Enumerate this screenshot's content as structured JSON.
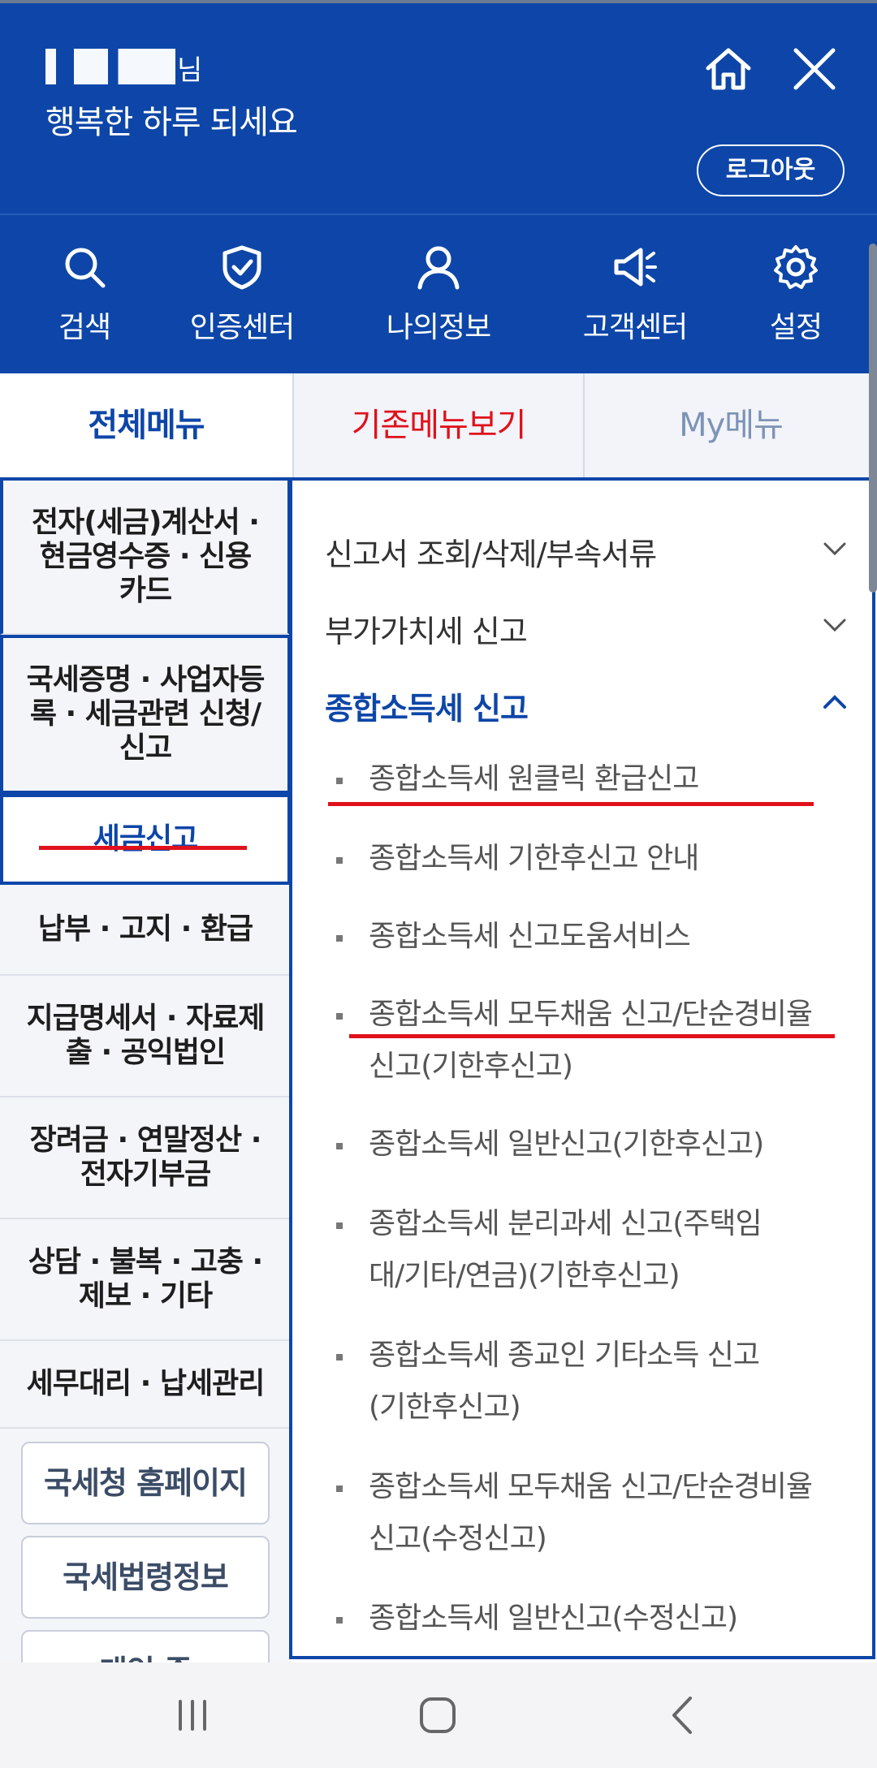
{
  "header": {
    "username_suffix": "님",
    "greeting": "행복한 하루 되세요",
    "logout_label": "로그아웃",
    "color": "#0d46a8"
  },
  "quick_nav": [
    {
      "label": "검색",
      "icon": "search-icon"
    },
    {
      "label": "인증센터",
      "icon": "shield-check-icon"
    },
    {
      "label": "나의정보",
      "icon": "user-icon"
    },
    {
      "label": "고객센터",
      "icon": "megaphone-icon"
    },
    {
      "label": "설정",
      "icon": "gear-icon"
    }
  ],
  "tabs": [
    {
      "label": "전체메뉴",
      "active": true
    },
    {
      "label": "기존메뉴보기",
      "color": "#e0111b"
    },
    {
      "label": "My메뉴"
    }
  ],
  "categories": [
    {
      "label": "전자(세금)계산서 · 현금영수증 · 신용카드"
    },
    {
      "label": "국세증명 · 사업자등록 · 세금관련 신청/신고"
    },
    {
      "label": "세금신고",
      "active": true
    },
    {
      "label": "납부 · 고지 · 환급"
    },
    {
      "label": "지급명세서 · 자료제출 · 공익법인"
    },
    {
      "label": "장려금 · 연말정산 · 전자기부금"
    },
    {
      "label": "상담 · 불복 · 고충 · 제보 · 기타"
    },
    {
      "label": "세무대리 · 납세관리"
    }
  ],
  "link_buttons": [
    {
      "label": "국세청 홈페이지"
    },
    {
      "label": "국세법령정보"
    },
    {
      "label": "개인 중"
    }
  ],
  "menu_sections": [
    {
      "label": "신고서 조회/삭제/부속서류",
      "expanded": false
    },
    {
      "label": "부가가치세 신고",
      "expanded": false
    },
    {
      "label": "종합소득세 신고",
      "expanded": true
    }
  ],
  "sub_items": [
    {
      "label": "종합소득세 원클릭 환급신고"
    },
    {
      "label": "종합소득세 기한후신고 안내"
    },
    {
      "label": "종합소득세 신고도움서비스"
    },
    {
      "label": "종합소득세 모두채움 신고/단순경비율 신고(기한후신고)"
    },
    {
      "label": "종합소득세 일반신고(기한후신고)"
    },
    {
      "label": "종합소득세 분리과세 신고(주택임대/기타/연금)(기한후신고)"
    },
    {
      "label": "종합소득세 종교인 기타소득 신고(기한후신고)"
    },
    {
      "label": "종합소득세 모두채움 신고/단순경비율 신고(수정신고)"
    },
    {
      "label": "종합소득세 일반신고(수정신고)"
    }
  ],
  "annotation_color": "#e0111b"
}
